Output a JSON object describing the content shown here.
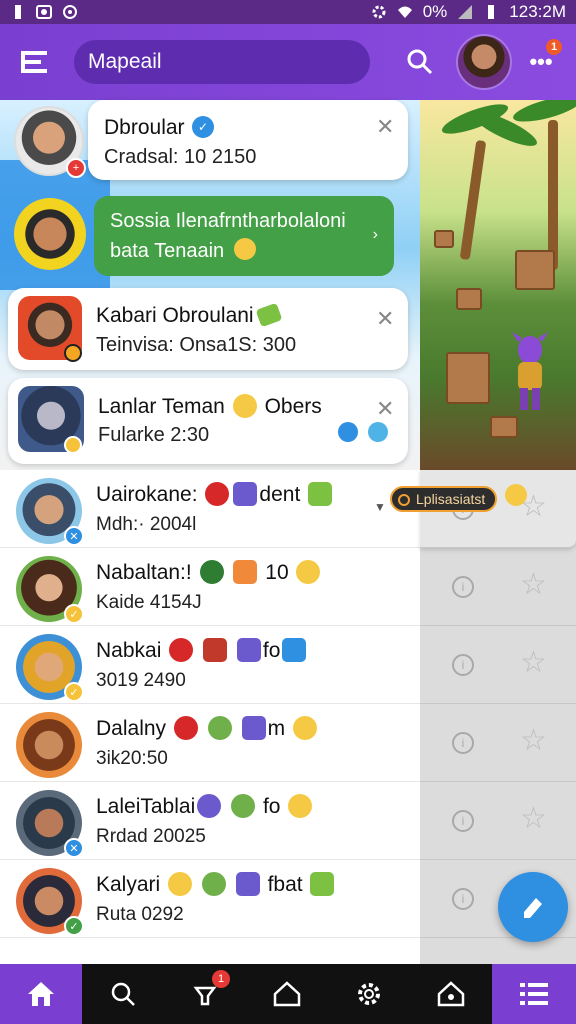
{
  "status_bar": {
    "battery": "0%",
    "time": "123:2M"
  },
  "header": {
    "search_text": "Mapeail",
    "more_badge": "1"
  },
  "top_cards": [
    {
      "title": "Dbroular",
      "subtitle": "Cradsal: 10 2150"
    },
    {
      "message_line1": "Sossia Ilenafrntharbolaloni",
      "message_line2": "bata Tenaain"
    },
    {
      "title": "Kabari Obroulani",
      "subtitle": "Teinvisa: Onsa1S: 300"
    },
    {
      "title": "Lanlar Teman",
      "title_suffix": "Obers",
      "subtitle": "Fularke 2:30"
    }
  ],
  "contacts": [
    {
      "name": "Uairokane:",
      "name_suffix": "dent",
      "subtitle": "Mdh:· 2004l"
    },
    {
      "name": "Nabaltan:!",
      "name_suffix": "10",
      "subtitle": "Kaide 4154J"
    },
    {
      "name": "Nabkai",
      "name_suffix": "fo",
      "subtitle": "3019 2490"
    },
    {
      "name": "Dalalny",
      "name_suffix": "m",
      "subtitle": "3ik20:50"
    },
    {
      "name": "LaleiTablai",
      "name_suffix": "fo",
      "subtitle": "Rrdad 20025"
    },
    {
      "name": "Kalyari",
      "name_suffix": "fbat",
      "subtitle": "Ruta 0292"
    }
  ],
  "tooltip": {
    "text": "Lplisasiatst"
  },
  "bottom_nav": {
    "notification_badge": "1"
  },
  "colors": {
    "primary": "#7a3fd0",
    "accent": "#43a047",
    "fab": "#2f8fe0"
  }
}
